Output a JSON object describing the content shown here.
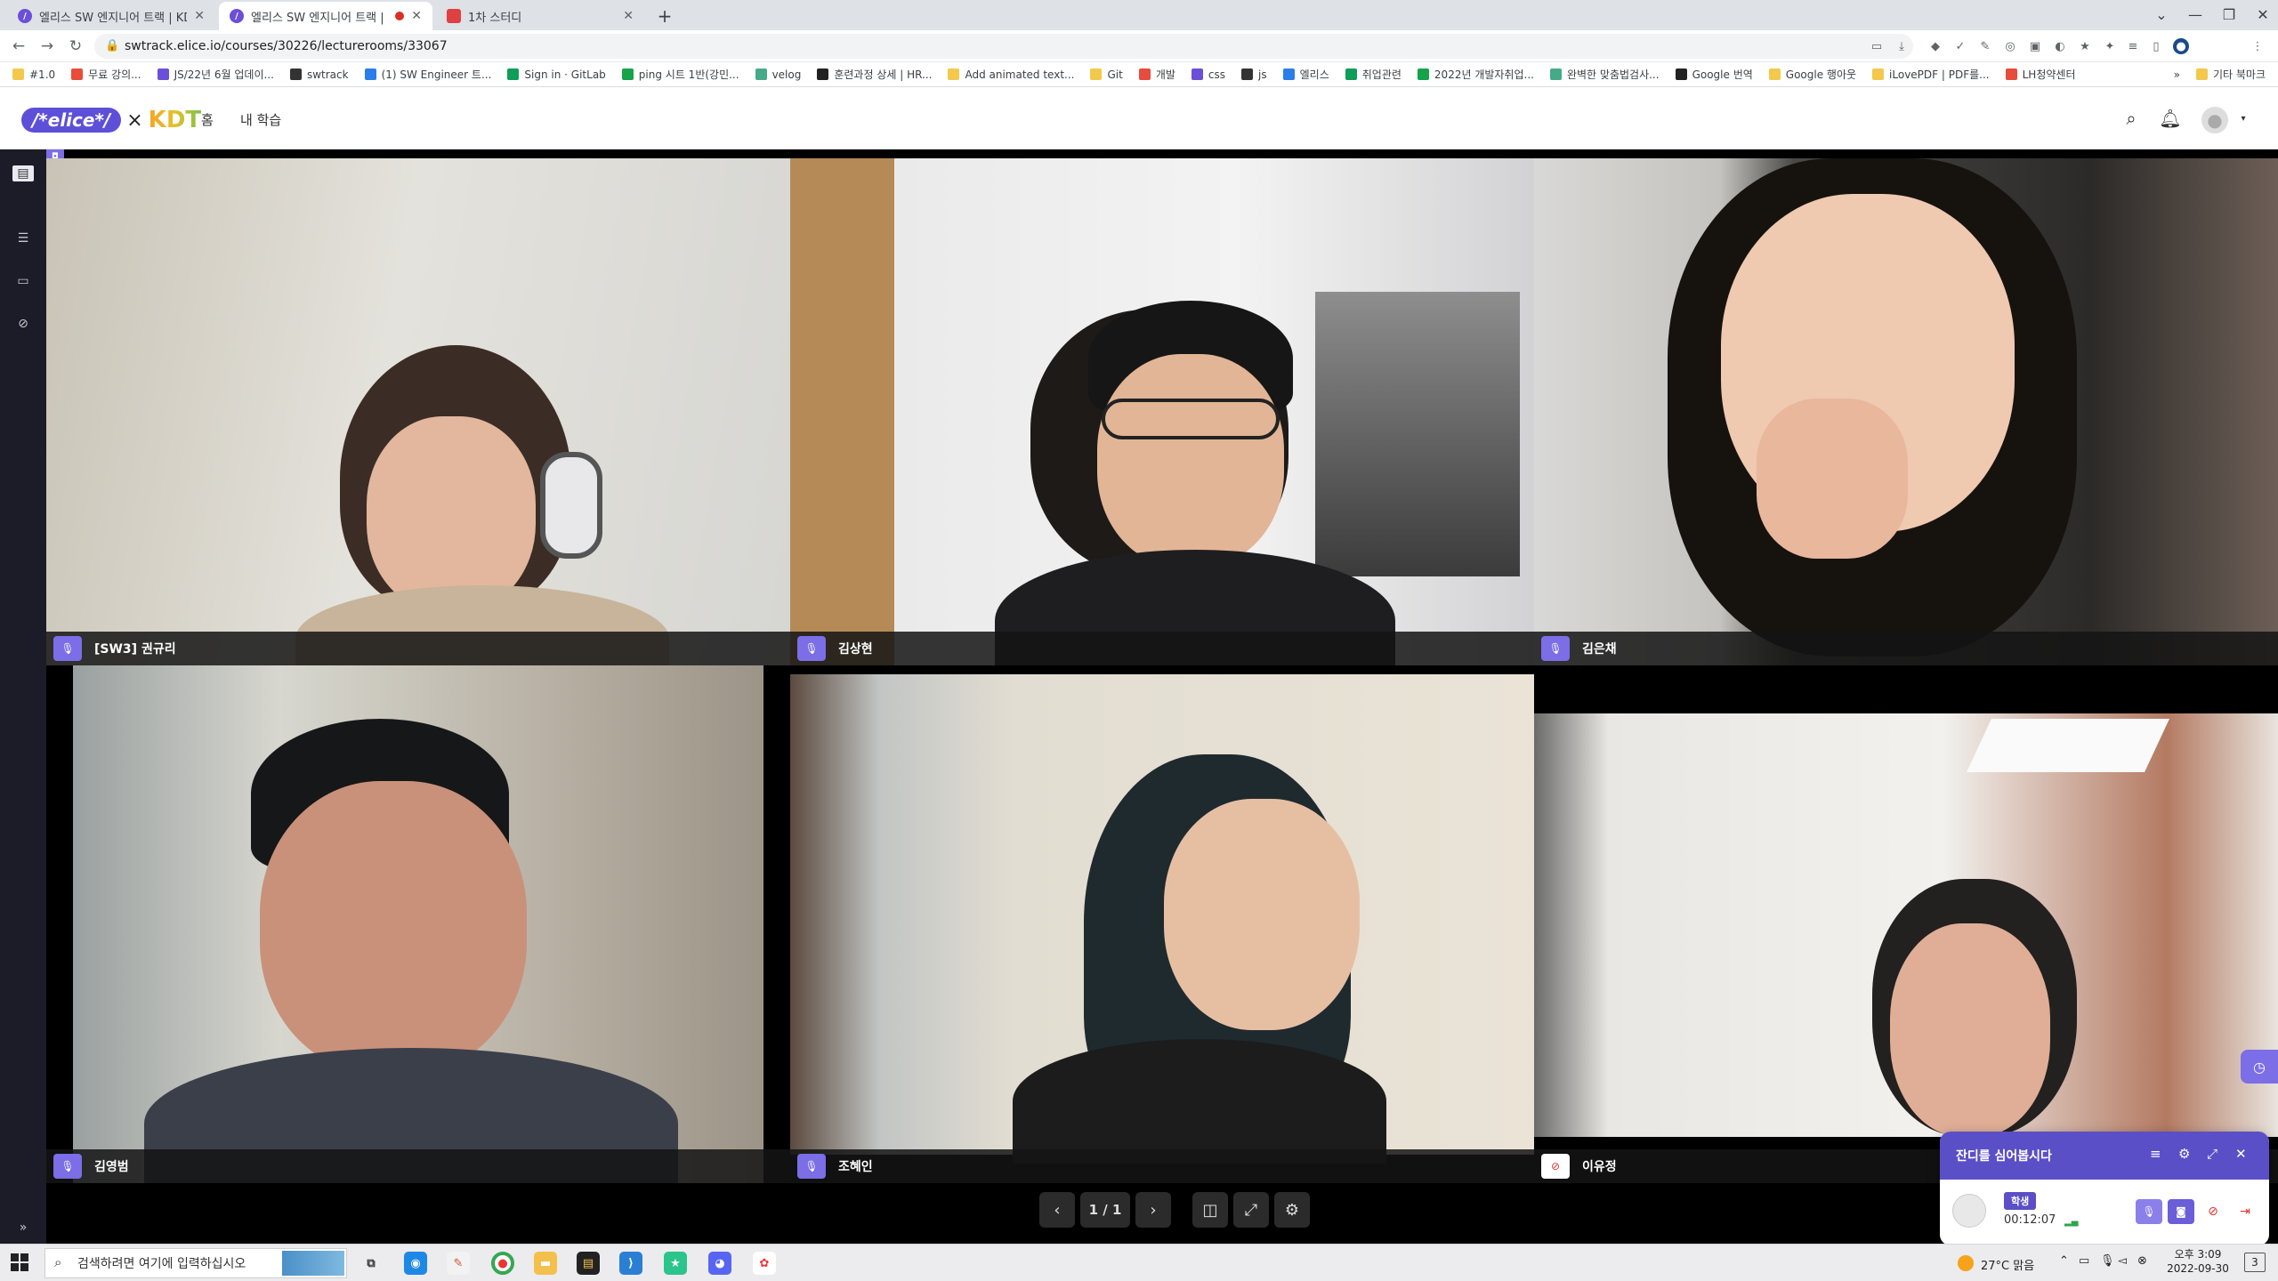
{
  "browser": {
    "tabs": [
      {
        "title": "엘리스 SW 엔지니어 트랙 | KDT",
        "active": false,
        "icon": "elice-icon"
      },
      {
        "title": "엘리스 SW 엔지니어 트랙 |",
        "active": true,
        "icon": "elice-icon",
        "recording": true
      },
      {
        "title": "1차 스터디",
        "active": false,
        "icon": "doc-icon"
      }
    ],
    "new_tab": "+",
    "url": "swtrack.elice.io/courses/30226/lecturerooms/33067",
    "bookmarks": [
      "#1.0",
      "무료 강의...",
      "JS/22년 6월 업데이...",
      "swtrack",
      "(1) SW Engineer 트...",
      "Sign in · GitLab",
      "ping 시트 1반(강민...",
      "velog",
      "훈련과정 상세 | HR...",
      "Add animated text...",
      "Git",
      "개발",
      "css",
      "js",
      "엘리스",
      "취업관련",
      "2022년 개발자취업...",
      "완벽한 맞춤법검사...",
      "Google 번역",
      "Google 행아웃",
      "iLovePDF | PDF를...",
      "LH청약센터"
    ],
    "bookmarks_more": "»",
    "bookmarks_other": "기타 북마크"
  },
  "app": {
    "logo_text": "/*elice*/",
    "logo_times": "×",
    "logo_kdt": "KDT",
    "nav": [
      "홈",
      "내 학습"
    ]
  },
  "participants": [
    {
      "name": "[SW3] 권규리",
      "mic": "on"
    },
    {
      "name": "김상현",
      "mic": "on"
    },
    {
      "name": "김은채",
      "mic": "on"
    },
    {
      "name": "김영범",
      "mic": "on"
    },
    {
      "name": "조혜인",
      "mic": "on"
    },
    {
      "name": "이유정",
      "mic": "off"
    }
  ],
  "pager": {
    "prev": "‹",
    "page": "1 / 1",
    "next": "›"
  },
  "panel": {
    "title": "잔디를 심어봅시다",
    "role_badge": "학생",
    "timer": "00:12:07"
  },
  "taskbar": {
    "search_placeholder": "검색하려면 여기에 입력하십시오",
    "weather": "27°C 맑음",
    "time": "오후 3:09",
    "date": "2022-09-30",
    "notifications": "3"
  },
  "colors": {
    "accent": "#5b4fc7",
    "mic_on": "#7b6ee6",
    "mic_off": "#d33333"
  }
}
